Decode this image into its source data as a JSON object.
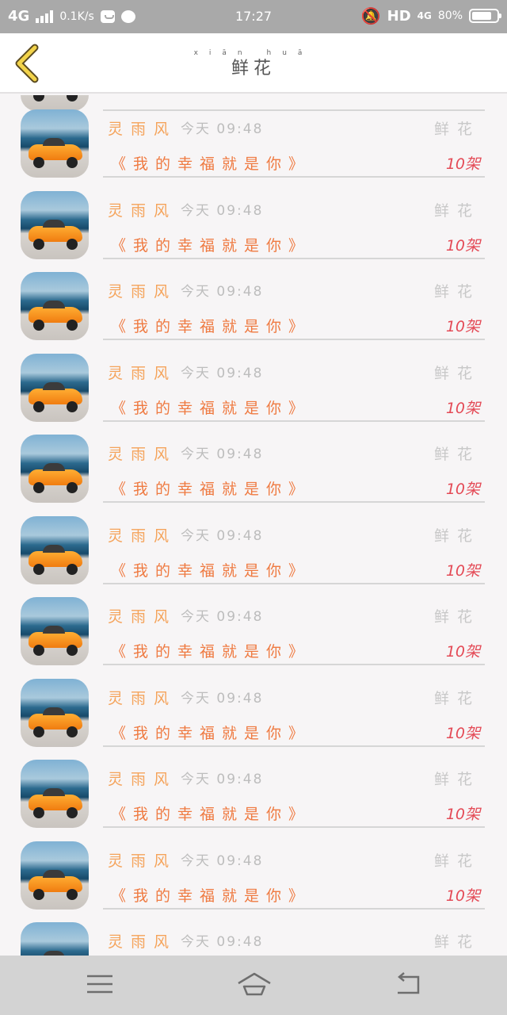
{
  "status_bar": {
    "network": "4G",
    "speed": "0.1K/s",
    "time": "17:27",
    "hd": "HD",
    "network_right": "4G",
    "battery": "80%",
    "battery_level": 0.8
  },
  "header": {
    "title": "鲜花",
    "title_pinyin": "xiān huā",
    "back_icon": "chevron-left-icon"
  },
  "list": {
    "items": [
      {
        "name": "灵雨风",
        "time_label": "今天",
        "time": "09:48",
        "tag": "鲜花",
        "song": "《我的幸福就是你》",
        "count": "10架"
      },
      {
        "name": "灵雨风",
        "time_label": "今天",
        "time": "09:48",
        "tag": "鲜花",
        "song": "《我的幸福就是你》",
        "count": "10架"
      },
      {
        "name": "灵雨风",
        "time_label": "今天",
        "time": "09:48",
        "tag": "鲜花",
        "song": "《我的幸福就是你》",
        "count": "10架"
      },
      {
        "name": "灵雨风",
        "time_label": "今天",
        "time": "09:48",
        "tag": "鲜花",
        "song": "《我的幸福就是你》",
        "count": "10架"
      },
      {
        "name": "灵雨风",
        "time_label": "今天",
        "time": "09:48",
        "tag": "鲜花",
        "song": "《我的幸福就是你》",
        "count": "10架"
      },
      {
        "name": "灵雨风",
        "time_label": "今天",
        "time": "09:48",
        "tag": "鲜花",
        "song": "《我的幸福就是你》",
        "count": "10架"
      },
      {
        "name": "灵雨风",
        "time_label": "今天",
        "time": "09:48",
        "tag": "鲜花",
        "song": "《我的幸福就是你》",
        "count": "10架"
      },
      {
        "name": "灵雨风",
        "time_label": "今天",
        "time": "09:48",
        "tag": "鲜花",
        "song": "《我的幸福就是你》",
        "count": "10架"
      },
      {
        "name": "灵雨风",
        "time_label": "今天",
        "time": "09:48",
        "tag": "鲜花",
        "song": "《我的幸福就是你》",
        "count": "10架"
      },
      {
        "name": "灵雨风",
        "time_label": "今天",
        "time": "09:48",
        "tag": "鲜花",
        "song": "《我的幸福就是你》",
        "count": "10架"
      },
      {
        "name": "灵雨风",
        "time_label": "今天",
        "time": "09:48",
        "tag": "鲜花",
        "song": "",
        "count": ""
      }
    ]
  },
  "navbar": {
    "menu_icon": "menu-icon",
    "home_icon": "home-icon",
    "back_icon": "back-arrow-icon"
  },
  "colors": {
    "name": "#f5a35a",
    "song": "#ef7a41",
    "count": "#e44a56",
    "muted": "#bdbdbd",
    "back_chevron": "#f2d34a"
  }
}
